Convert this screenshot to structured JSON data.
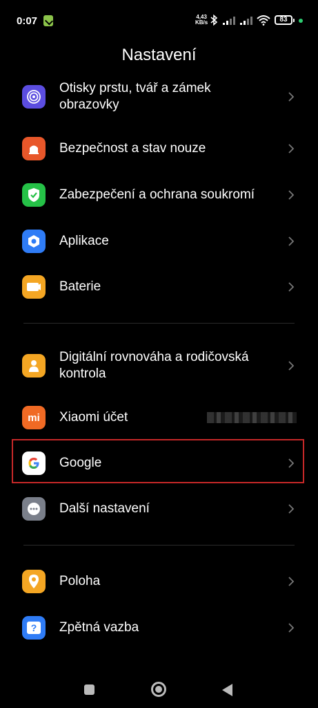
{
  "status_bar": {
    "time": "0:07",
    "net_speed_value": "4,43",
    "net_speed_unit": "KB/s",
    "battery": "83"
  },
  "header": {
    "title": "Nastavení"
  },
  "items": [
    {
      "label": "Otisky prstu, tvář a zámek obrazovky",
      "icon": "fingerprint-icon",
      "color": "#5b4de0"
    },
    {
      "label": "Bezpečnost a stav nouze",
      "icon": "emergency-light-icon",
      "color": "#e8572a"
    },
    {
      "label": "Zabezpečení a ochrana soukromí",
      "icon": "shield-check-icon",
      "color": "#25c147"
    },
    {
      "label": "Aplikace",
      "icon": "apps-hexagon-icon",
      "color": "#2f7cf6"
    },
    {
      "label": "Baterie",
      "icon": "battery-icon",
      "color": "#f4a623"
    },
    {
      "label": "Digitální rovnováha a rodičovská kontrola",
      "icon": "parental-control-icon",
      "color": "#f4a623"
    },
    {
      "label": "Xiaomi účet",
      "icon": "mi-logo-icon",
      "color": "#f06a24"
    },
    {
      "label": "Google",
      "icon": "google-g-icon",
      "color": "#ffffff"
    },
    {
      "label": "Další nastavení",
      "icon": "more-dots-icon",
      "color": "#7a7f8a"
    },
    {
      "label": "Poloha",
      "icon": "location-pin-icon",
      "color": "#f4a623"
    },
    {
      "label": "Zpětná vazba",
      "icon": "feedback-icon",
      "color": "#2f7cf6"
    }
  ],
  "xiaomi_logo_text": "mi",
  "feedback_icon_text": "?"
}
